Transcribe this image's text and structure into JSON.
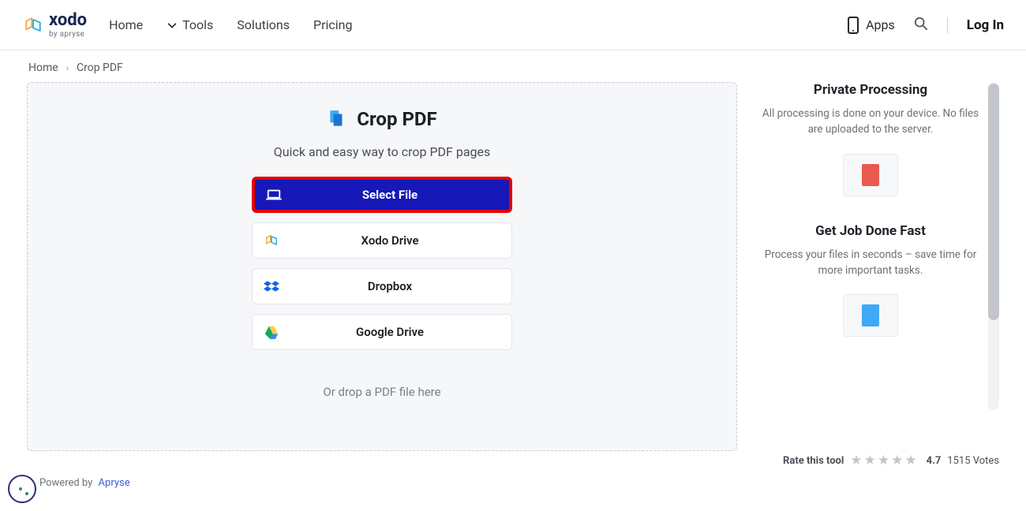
{
  "brand": {
    "name": "xodo",
    "subtitle": "by apryse"
  },
  "nav": {
    "home": "Home",
    "tools": "Tools",
    "solutions": "Solutions",
    "pricing": "Pricing",
    "apps": "Apps",
    "login": "Log In"
  },
  "breadcrumb": {
    "home": "Home",
    "current": "Crop PDF"
  },
  "tool": {
    "title": "Crop PDF",
    "subtitle": "Quick and easy way to crop PDF pages",
    "select_file": "Select File",
    "xodo_drive": "Xodo Drive",
    "dropbox": "Dropbox",
    "google_drive": "Google Drive",
    "drop_hint": "Or drop a PDF file here"
  },
  "sidebar": {
    "features": [
      {
        "title": "Private Processing",
        "desc": "All processing is done on your device. No files are uploaded to the server."
      },
      {
        "title": "Get Job Done Fast",
        "desc": "Process your files in seconds – save time for more important tasks."
      }
    ]
  },
  "rating": {
    "label": "Rate this tool",
    "value": "4.7",
    "votes": "1515 Votes"
  },
  "footer": {
    "powered": "Powered by",
    "vendor": "Apryse"
  }
}
